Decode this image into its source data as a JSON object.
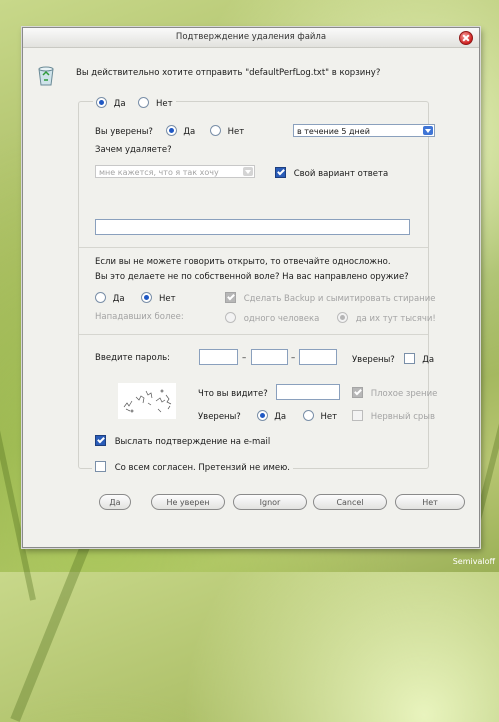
{
  "window": {
    "title": "Подтверждение удаления файла"
  },
  "question": "Вы действительно хотите отправить \"defaultPerfLog.txt\" в корзину?",
  "group_top": {
    "yes": "Да",
    "no": "Нет"
  },
  "sure": {
    "label": "Вы уверены?",
    "yes": "Да",
    "no": "Нет",
    "period_value": "в течение 5 дней"
  },
  "why": {
    "label": "Зачем удаляете?",
    "dropdown_value": "мне кажется, что я так хочу",
    "own_answer_label": "Свой вариант ответа",
    "own_answer_value": ""
  },
  "honest": {
    "line1": "Если вы не можете говорить открыто, то отвечайте односложно.",
    "line2": "Вы это делаете не по собственной воле? На вас направлено оружие?",
    "yes": "Да",
    "no": "Нет",
    "backup_label": "Сделать Backup и сымитировать стирание",
    "attackers_label": "Нападавших более:",
    "one_person": "одного человека",
    "thousands": "да их тут тысячи!"
  },
  "password": {
    "label": "Введите пароль:",
    "dash": "–",
    "sure_label": "Уверены?",
    "yes": "Да"
  },
  "captcha": {
    "what_label": "Что вы видите?",
    "bad_vision": "Плохое зрение",
    "sure_label": "Уверены?",
    "yes": "Да",
    "no": "Нет",
    "nervous": "Нервный срыв"
  },
  "email_label": "Выслать подтверждение на e-mail",
  "agree_label": "Со всем согласен. Претензий не имею.",
  "buttons": {
    "yes": "Да",
    "unsure": "Не уверен",
    "ignore": "Ignor",
    "cancel": "Cancel",
    "no": "Нет"
  },
  "signature": "Semivaloff",
  "colors": {
    "accent": "#1f58c4",
    "close": "#d0201f",
    "window_bg": "#f1f1ed"
  }
}
